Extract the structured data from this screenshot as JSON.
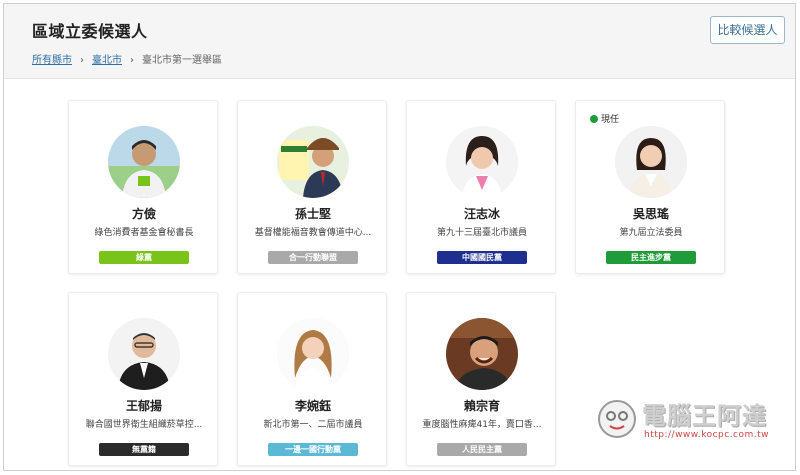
{
  "header": {
    "title": "區域立委候選人",
    "compare_button": "比較候選人",
    "breadcrumb": {
      "level1": "所有縣市",
      "level2": "臺北市",
      "current": "臺北市第一選舉區",
      "separator": "›"
    }
  },
  "candidates": [
    {
      "name": "方儉",
      "title": "綠色消費者基金會秘書長",
      "party": "綠黨",
      "party_color": "#7ac31a",
      "incumbent": false
    },
    {
      "name": "孫士堅",
      "title": "基督權能福音教會傳道中心...",
      "party": "合一行動聯盟",
      "party_color": "#a9a9a9",
      "incumbent": false
    },
    {
      "name": "汪志冰",
      "title": "第九十三屆臺北市議員",
      "party": "中國國民黨",
      "party_color": "#1f2f8f",
      "incumbent": false
    },
    {
      "name": "吳思瑤",
      "title": "第九屆立法委員",
      "party": "民主進步黨",
      "party_color": "#1f9b3a",
      "incumbent": true,
      "incumbent_label": "現任"
    },
    {
      "name": "王郁揚",
      "title": "聯合國世界衛生組織菸草控...",
      "party": "無黨籍",
      "party_color": "#2b2b2b",
      "incumbent": false
    },
    {
      "name": "李婉鈺",
      "title": "新北市第一、二屆市議員",
      "party": "一邊一國行動黨",
      "party_color": "#5bb9d6",
      "incumbent": false
    },
    {
      "name": "賴宗育",
      "title": "重度腦性麻痺41年，賣口香...",
      "party": "人民民主黨",
      "party_color": "#a9a9a9",
      "incumbent": false
    }
  ],
  "watermark": {
    "text": "電腦王阿達",
    "url": "http://www.kocpc.com.tw"
  }
}
